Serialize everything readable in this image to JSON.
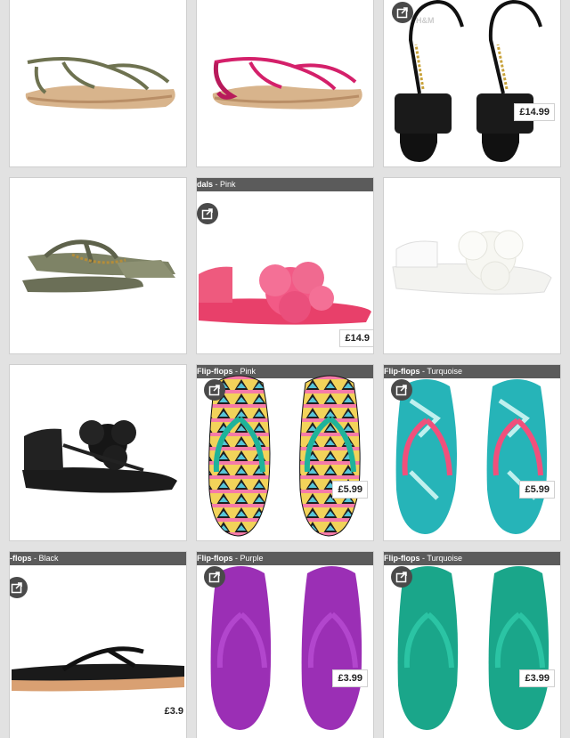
{
  "products": [
    {
      "id": "olive-tstrap-sandal",
      "price": "",
      "label": "",
      "colour": ""
    },
    {
      "id": "pink-tstrap-sandal",
      "price": "",
      "label": "",
      "colour": ""
    },
    {
      "id": "black-chain-sandal",
      "price": "£14.99",
      "label": "",
      "colour": ""
    },
    {
      "id": "khaki-chain-sandal",
      "price": "",
      "label": "",
      "colour": ""
    },
    {
      "id": "pink-flower-sandal",
      "price": "£14.9",
      "label": "dals",
      "colour": "Pink"
    },
    {
      "id": "white-flower-sandal",
      "price": "",
      "label": "",
      "colour": ""
    },
    {
      "id": "black-flower-sandal",
      "price": "",
      "label": "",
      "colour": ""
    },
    {
      "id": "aztec-flipflop",
      "price": "£5.99",
      "label": "Flip-flops",
      "colour": "Pink"
    },
    {
      "id": "turquoise-print-flipflop",
      "price": "£5.99",
      "label": "Flip-flops",
      "colour": "Turquoise"
    },
    {
      "id": "black-flipflop",
      "price": "£3.9",
      "label": "-flops",
      "colour": "Black"
    },
    {
      "id": "purple-flipflop",
      "price": "£3.99",
      "label": "Flip-flops",
      "colour": "Purple"
    },
    {
      "id": "turquoise-flipflop",
      "price": "£3.99",
      "label": "Flip-flops",
      "colour": "Turquoise"
    }
  ],
  "brand_logo": "H&M",
  "colors": {
    "accent_pink": "#f0507c",
    "turquoise": "#2bb7b3",
    "purple": "#9b2fb5",
    "olive": "#6e7250",
    "background": "#e2e2e2"
  }
}
